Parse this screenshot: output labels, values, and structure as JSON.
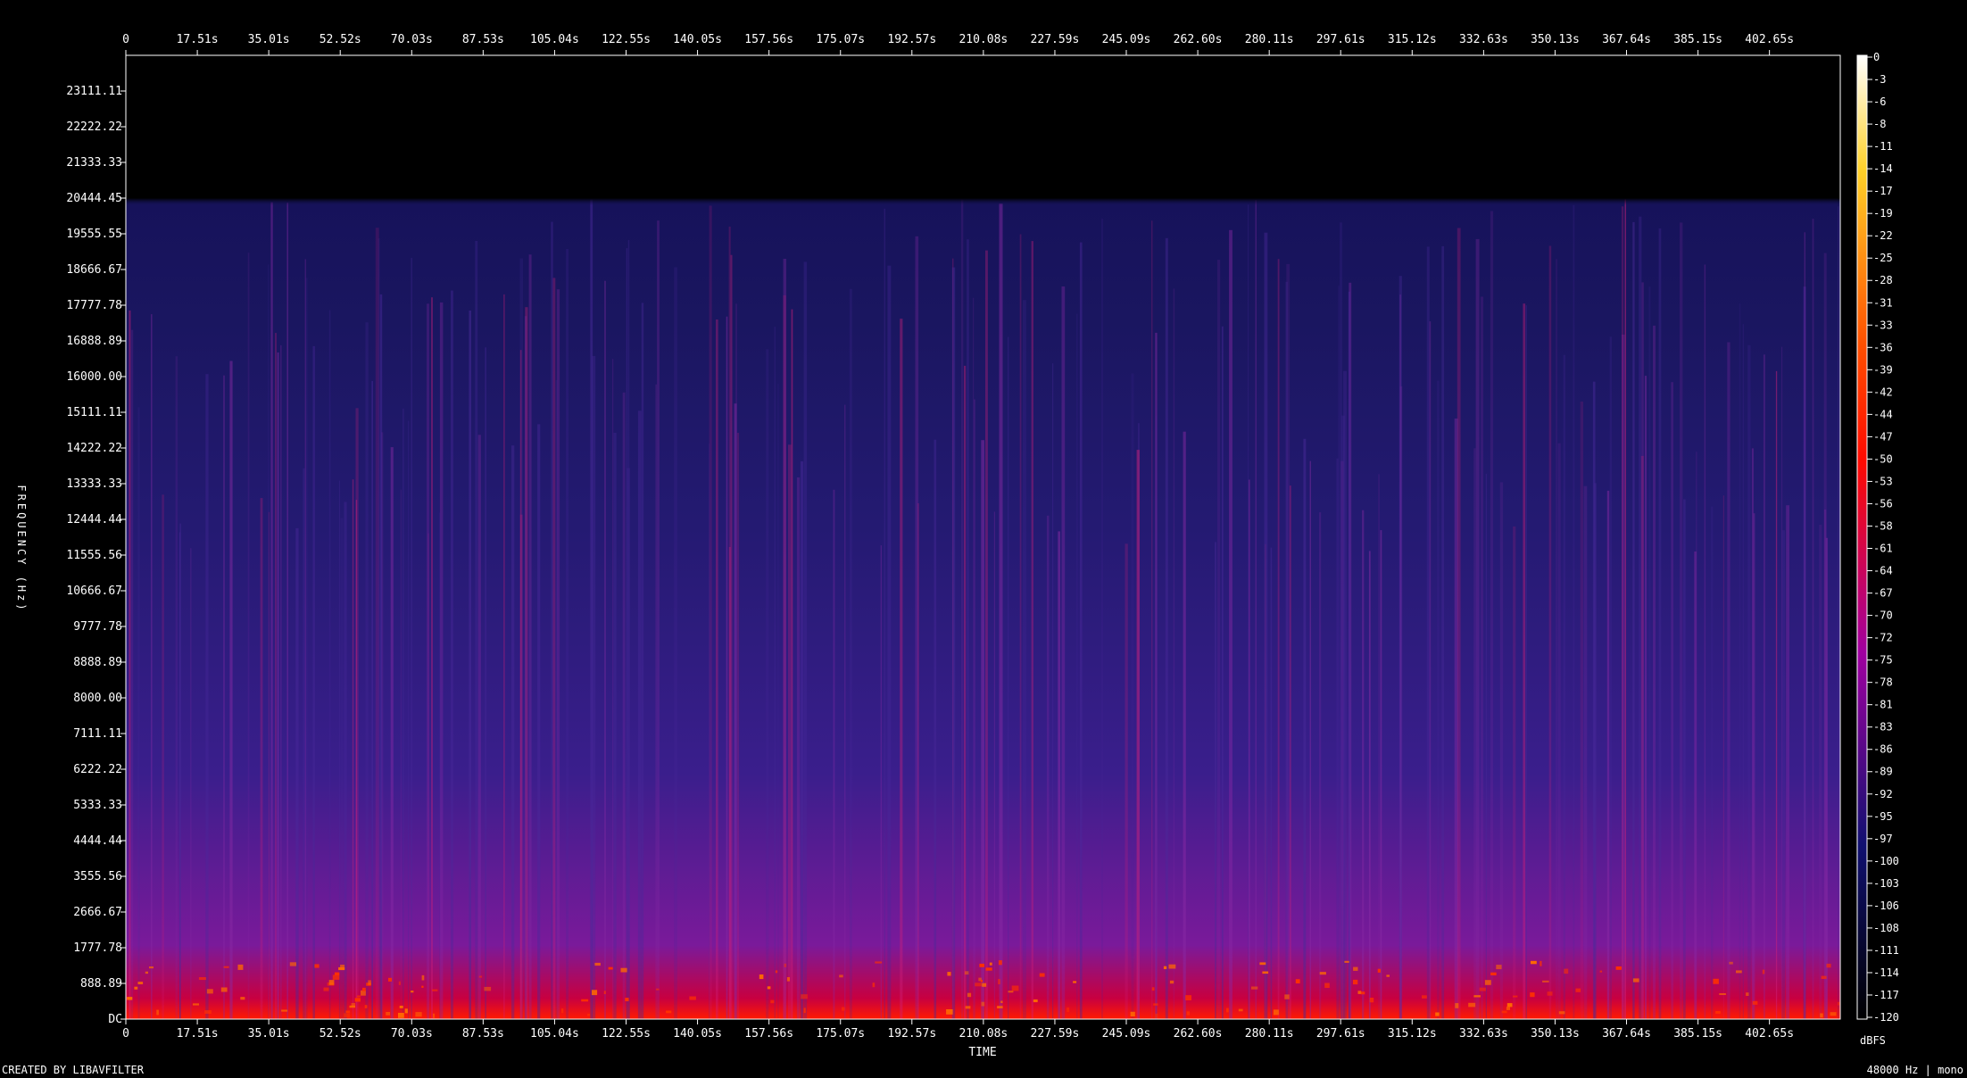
{
  "chart_data": {
    "type": "heatmap",
    "title": "",
    "xlabel": "TIME",
    "ylabel": "FREQUENCY (Hz)",
    "x_unit": "s",
    "y_unit": "Hz",
    "xlim": [
      0,
      420
    ],
    "ylim": [
      0,
      24000
    ],
    "x_ticks": [
      "0",
      "17.51s",
      "35.01s",
      "52.52s",
      "70.03s",
      "87.53s",
      "105.04s",
      "122.55s",
      "140.05s",
      "157.56s",
      "175.07s",
      "192.57s",
      "210.08s",
      "227.59s",
      "245.09s",
      "262.60s",
      "280.11s",
      "297.61s",
      "315.12s",
      "332.63s",
      "350.13s",
      "367.64s",
      "385.15s",
      "402.65s"
    ],
    "x_tick_values": [
      0,
      17.51,
      35.01,
      52.52,
      70.03,
      87.53,
      105.04,
      122.55,
      140.05,
      157.56,
      175.07,
      192.57,
      210.08,
      227.59,
      245.09,
      262.6,
      280.11,
      297.61,
      315.12,
      332.63,
      350.13,
      367.64,
      385.15,
      402.65
    ],
    "y_ticks": [
      "23111.11",
      "22222.22",
      "21333.33",
      "20444.45",
      "19555.55",
      "18666.67",
      "17777.78",
      "16888.89",
      "16000.00",
      "15111.11",
      "14222.22",
      "13333.33",
      "12444.44",
      "11555.56",
      "10666.67",
      "9777.78",
      "8888.89",
      "8000.00",
      "7111.11",
      "6222.22",
      "5333.33",
      "4444.44",
      "3555.56",
      "2666.67",
      "1777.78",
      "888.89",
      "DC"
    ],
    "y_tick_values": [
      23111.11,
      22222.22,
      21333.33,
      20444.45,
      19555.55,
      18666.67,
      17777.78,
      16888.89,
      16000.0,
      15111.11,
      14222.22,
      13333.33,
      12444.44,
      11555.56,
      10666.67,
      9777.78,
      8888.89,
      8000.0,
      7111.11,
      6222.22,
      5333.33,
      4444.44,
      3555.56,
      2666.67,
      1777.78,
      888.89,
      0
    ],
    "content_cutoff_hz": 20444.45,
    "colorbar": {
      "label": "dBFS",
      "range": [
        -120,
        0
      ],
      "ticks": [
        "0",
        "-3",
        "-6",
        "-8",
        "-11",
        "-14",
        "-17",
        "-19",
        "-22",
        "-25",
        "-28",
        "-31",
        "-33",
        "-36",
        "-39",
        "-42",
        "-44",
        "-47",
        "-50",
        "-53",
        "-56",
        "-58",
        "-61",
        "-64",
        "-67",
        "-70",
        "-72",
        "-75",
        "-78",
        "-81",
        "-83",
        "-86",
        "-89",
        "-92",
        "-95",
        "-97",
        "-100",
        "-103",
        "-106",
        "-108",
        "-111",
        "-114",
        "-117",
        "-120"
      ],
      "colors": [
        "#ffffff",
        "#ffd028",
        "#ff2000",
        "#b000b0",
        "#0a0a60",
        "#000000"
      ]
    },
    "grid": false
  },
  "footer": {
    "credit": "CREATED BY LIBAVFILTER",
    "format": "48000 Hz | mono"
  }
}
